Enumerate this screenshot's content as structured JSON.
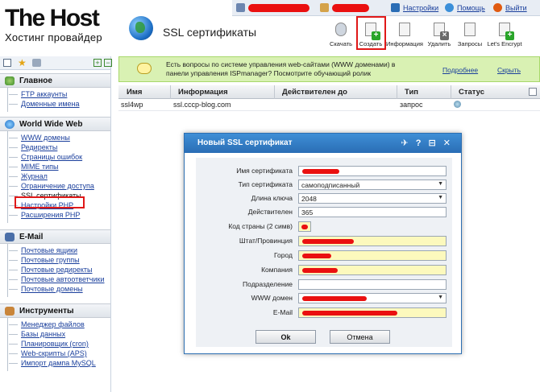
{
  "logo": {
    "brand": "The Host",
    "tagline": "Хостинг провайдер"
  },
  "page_title": "SSL сертификаты",
  "topbar": {
    "settings": "Настройки",
    "help": "Помощь",
    "logout": "Выйти"
  },
  "toolbar": {
    "download": "Скачать",
    "create": "Создать",
    "info": "Информация",
    "delete": "Удалить",
    "requests": "Запросы",
    "letsencrypt": "Let's Encrypt"
  },
  "sidebar": {
    "sections": [
      {
        "title": "Главное",
        "items": [
          "FTP аккаунты",
          "Доменные имена"
        ]
      },
      {
        "title": "World Wide Web",
        "items": [
          "WWW домены",
          "Редиректы",
          "Страницы ошибок",
          "MIME типы",
          "Журнал",
          "Ограничение доступа",
          "SSL сертификаты",
          "Настройки PHP",
          "Расширения PHP"
        ]
      },
      {
        "title": "E-Mail",
        "items": [
          "Почтовые ящики",
          "Почтовые группы",
          "Почтовые редиректы",
          "Почтовые автоответчики",
          "Почтовые домены"
        ]
      },
      {
        "title": "Инструменты",
        "items": [
          "Менеджер файлов",
          "Базы данных",
          "Планировщик (cron)",
          "Web-скрипты (APS)",
          "Импорт дампа MySQL"
        ]
      }
    ]
  },
  "notice": {
    "text": "Есть вопросы по системе управления web-сайтами (WWW доменами) в панели управления ISPmanager? Посмотрите обучающий ролик",
    "link_more": "Подробнее",
    "link_hide": "Скрыть"
  },
  "grid": {
    "columns": [
      "Имя",
      "Информация",
      "Действителен до",
      "Тип",
      "Статус"
    ],
    "rows": [
      {
        "name": "ssl4wp",
        "info": "ssl.cccp-blog.com",
        "valid_until": "",
        "type": "запрос"
      }
    ]
  },
  "dialog": {
    "title": "Новый SSL сертификат",
    "tools": "✈ ? ⊟ ✕",
    "fields": [
      {
        "label": "Имя сертификата",
        "value": ""
      },
      {
        "label": "Тип сертификата",
        "value": "самоподписанный"
      },
      {
        "label": "Длина ключа",
        "value": "2048"
      },
      {
        "label": "Действителен",
        "value": "365"
      },
      {
        "label": "Код страны (2 симв)",
        "value": ""
      },
      {
        "label": "Штат/Провинция",
        "value": ""
      },
      {
        "label": "Город",
        "value": ""
      },
      {
        "label": "Компания",
        "value": ""
      },
      {
        "label": "Подразделение",
        "value": ""
      },
      {
        "label": "WWW домен",
        "value": ""
      },
      {
        "label": "E-Mail",
        "value": ""
      }
    ],
    "ok": "Ok",
    "cancel": "Отмена"
  },
  "colors": {
    "accent_blue": "#2a6db5",
    "notice_green": "#d9f1b3",
    "highlight_red": "#e01818",
    "required_yellow": "#fcf9bd"
  }
}
